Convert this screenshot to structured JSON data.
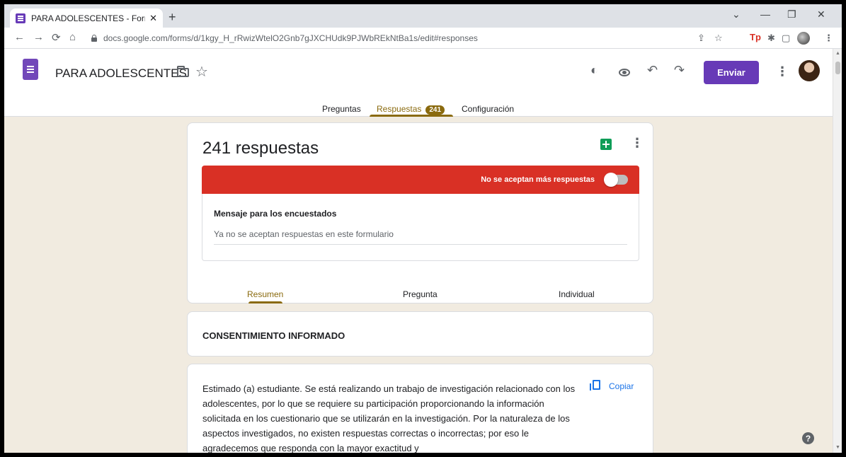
{
  "browser": {
    "tab_title": "PARA ADOLESCENTES - Formula",
    "tab_close": "✕",
    "new_tab": "+",
    "url": "docs.google.com/forms/d/1kgy_H_rRwizWtelO2Gnb7gJXCHUdk9PJWbREkNtBa1s/edit#responses",
    "nav": {
      "back": "←",
      "forward": "→",
      "reload": "⟳",
      "home": "⌂"
    },
    "window": {
      "minimize": "—",
      "restore": "❐",
      "close": "✕",
      "collapse": "⌄"
    },
    "extensions": {
      "share": "⇪",
      "star": "☆",
      "tp": "Tp",
      "puzzle": "✱",
      "panel": "▢",
      "menu": "⋮"
    }
  },
  "form": {
    "title": "PARA ADOLESCENTES",
    "send_label": "Enviar",
    "tabs": [
      {
        "label": "Preguntas"
      },
      {
        "label": "Respuestas",
        "badge": "241"
      },
      {
        "label": "Configuración"
      }
    ],
    "header_icons": {
      "palette": "◐",
      "undo": "↶",
      "redo": "↷",
      "more": "⋮",
      "star": "☆"
    }
  },
  "responses": {
    "count_label": "241 respuestas",
    "closed_label": "No se aceptan más respuestas",
    "message_label": "Mensaje para los encuestados",
    "message_value": "Ya no se aceptan respuestas en este formulario",
    "subtabs": [
      "Resumen",
      "Pregunta",
      "Individual"
    ],
    "more": "⋮"
  },
  "sections": {
    "consent_title": "CONSENTIMIENTO INFORMADO",
    "intro_text": "Estimado (a) estudiante. Se está realizando un trabajo de investigación relacionado con los adolescentes, por lo que se requiere su participación proporcionando la información solicitada en los cuestionario que se utilizarán en la investigación. Por la naturaleza de los aspectos investigados, no existen respuestas correctas o incorrectas; por eso le agradecemos que responda con la mayor exactitud y",
    "copy_label": "Copiar"
  },
  "help": "?",
  "colors": {
    "accent": "#673ab7",
    "responses_accent": "#8a6a0e",
    "closed_bar": "#d93025",
    "background": "#f1ebe0",
    "link": "#1a73e8"
  }
}
